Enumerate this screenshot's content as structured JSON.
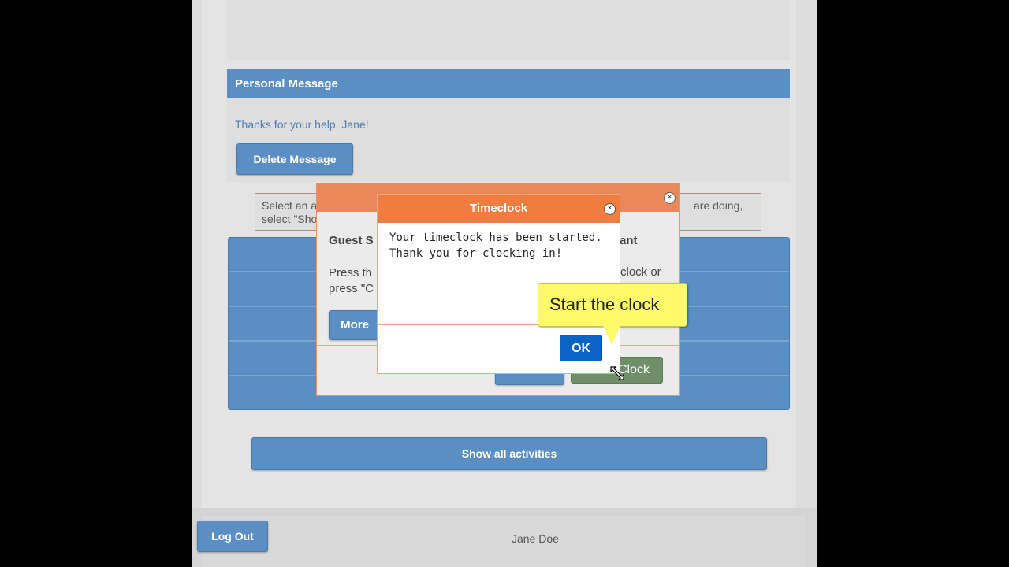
{
  "personal_message": {
    "header": "Personal Message",
    "text": "Thanks for your help, Jane!",
    "delete_label": "Delete Message"
  },
  "info_box": {
    "line1_left": "Select an acti",
    "line2_left": "select \"Show",
    "line1_right": "are doing,"
  },
  "show_all_label": "Show all activities",
  "footer": {
    "logout_label": "Log Out",
    "user_name": "Jane Doe"
  },
  "background_dialog": {
    "title_left": "Guest S",
    "title_right": "ant",
    "text_line1": "Press th",
    "text_line2": "press \"C",
    "text_right": "clock or",
    "more_label": "More",
    "clock_label": "Clock"
  },
  "modal": {
    "title": "Timeclock",
    "message_line1": "Your timeclock has been started.",
    "message_line2": "Thank you for clocking in!",
    "ok_label": "OK",
    "close_glyph": "×"
  },
  "tooltip": {
    "text": "Start the clock"
  },
  "colors": {
    "accent_blue": "#5b8fc4",
    "modal_orange": "#f07d3f",
    "ok_blue": "#0a64c8",
    "tooltip_yellow": "#fffa6a"
  }
}
